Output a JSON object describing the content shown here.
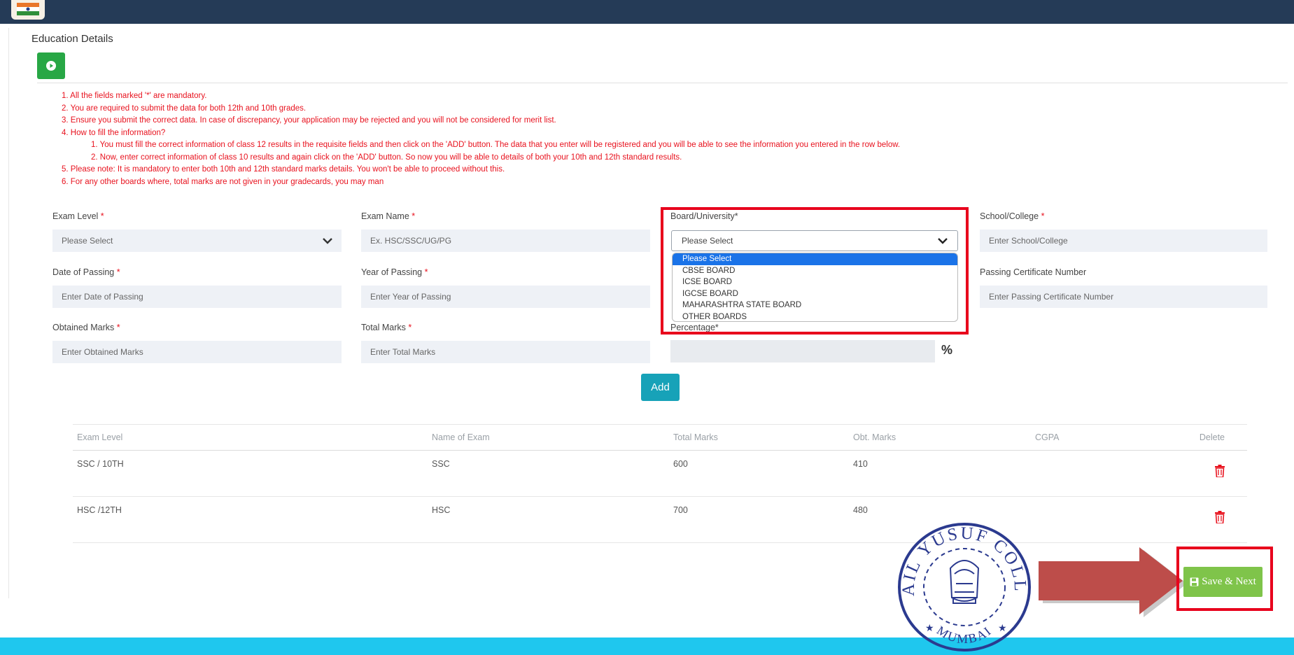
{
  "section_title": "Education Details",
  "instructions": [
    "1. All the fields marked '*' are mandatory.",
    "2. You are required to submit the data for both 12th and 10th grades.",
    "3. Ensure you submit the correct data. In case of discrepancy, your application may be rejected and you will not be considered for merit list.",
    "4. How to fill the information?",
    "1. You must fill the correct information of class 12 results in the requisite fields and then click on the 'ADD' button. The data that you enter will be registered and you will be able to see the information you entered in the row below.",
    "2. Now, enter correct information of class 10 results and again click on the 'ADD' button. So now you will be able to details of both your 10th and 12th standard results.",
    "5. Please note: It is mandatory to enter both 10th and 12th standard marks details. You won't be able to proceed without this.",
    "6. For any other boards where, total marks are not given in your gradecards, you may man"
  ],
  "form": {
    "exam_level": {
      "label": "Exam Level",
      "value": "Please Select"
    },
    "exam_name": {
      "label": "Exam Name",
      "placeholder": "Ex. HSC/SSC/UG/PG"
    },
    "board": {
      "label": "Board/University*",
      "value": "Please Select",
      "options": [
        "Please Select",
        "CBSE BOARD",
        "ICSE BOARD",
        "IGCSE BOARD",
        "MAHARASHTRA STATE BOARD",
        "OTHER BOARDS"
      ]
    },
    "school": {
      "label": "School/College",
      "placeholder": "Enter School/College"
    },
    "date_of_passing": {
      "label": "Date of Passing",
      "placeholder": "Enter Date of Passing"
    },
    "year_of_passing": {
      "label": "Year of Passing",
      "placeholder": "Enter Year of Passing"
    },
    "certificate": {
      "label": "Passing Certificate Number",
      "placeholder": "Enter Passing Certificate Number"
    },
    "obtained_marks": {
      "label": "Obtained Marks",
      "placeholder": "Enter Obtained Marks"
    },
    "total_marks": {
      "label": "Total Marks",
      "placeholder": "Enter Total Marks"
    },
    "percentage": {
      "label": "Percentage*",
      "unit": "%"
    },
    "required_mark": "*",
    "add_label": "Add"
  },
  "table": {
    "headers": [
      "Exam Level",
      "Name of Exam",
      "Total Marks",
      "Obt. Marks",
      "CGPA",
      "Delete"
    ],
    "rows": [
      {
        "level": "SSC / 10TH",
        "name": "SSC",
        "total": "600",
        "obtained": "410",
        "cgpa": ""
      },
      {
        "level": "HSC /12TH",
        "name": "HSC",
        "total": "700",
        "obtained": "480",
        "cgpa": ""
      }
    ]
  },
  "seal": {
    "top_text": "ISMAIL YUSUF COLLEGE",
    "bottom_text": "MUMBAI"
  },
  "save_label": "Save & Next",
  "colors": {
    "accent_red": "#e8121e",
    "topbar": "#253b57",
    "add_button": "#17a2b8",
    "save_button": "#7fc44a",
    "bottom_band": "#1fc7ee"
  }
}
